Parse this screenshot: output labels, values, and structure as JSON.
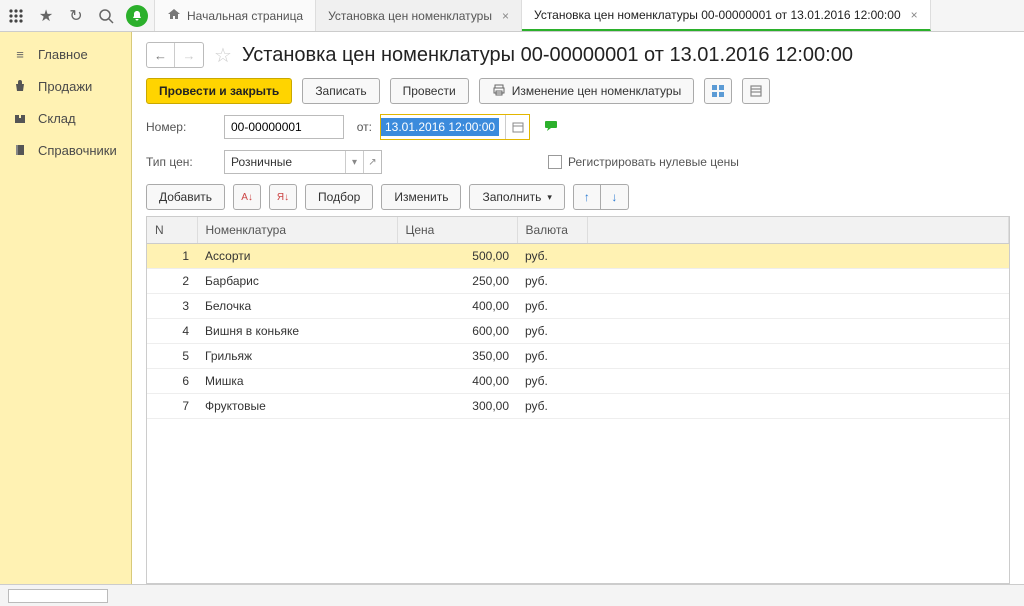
{
  "tabs": {
    "home": "Начальная страница",
    "t1": "Установка цен номенклатуры",
    "t2": "Установка цен номенклатуры 00-00000001 от 13.01.2016 12:00:00"
  },
  "sidebar": [
    {
      "label": "Главное",
      "name": "sidebar-main"
    },
    {
      "label": "Продажи",
      "name": "sidebar-sales"
    },
    {
      "label": "Склад",
      "name": "sidebar-warehouse"
    },
    {
      "label": "Справочники",
      "name": "sidebar-catalogs"
    }
  ],
  "title": "Установка цен номенклатуры 00-00000001 от 13.01.2016 12:00:00",
  "cmd": {
    "post_close": "Провести и закрыть",
    "write": "Записать",
    "post": "Провести",
    "price_change": "Изменение цен номенклатуры"
  },
  "fields": {
    "number_label": "Номер:",
    "number_value": "00-00000001",
    "date_label": "от:",
    "date_value": "13.01.2016 12:00:00",
    "type_label": "Тип цен:",
    "type_value": "Розничные",
    "reg_zero": "Регистрировать нулевые цены"
  },
  "tbl_tools": {
    "add": "Добавить",
    "pick": "Подбор",
    "change": "Изменить",
    "fill": "Заполнить"
  },
  "columns": {
    "n": "N",
    "nom": "Номенклатура",
    "price": "Цена",
    "cur": "Валюта"
  },
  "rows": [
    {
      "n": "1",
      "nom": "Ассорти",
      "price": "500,00",
      "cur": "руб."
    },
    {
      "n": "2",
      "nom": "Барбарис",
      "price": "250,00",
      "cur": "руб."
    },
    {
      "n": "3",
      "nom": "Белочка",
      "price": "400,00",
      "cur": "руб."
    },
    {
      "n": "4",
      "nom": "Вишня в коньяке",
      "price": "600,00",
      "cur": "руб."
    },
    {
      "n": "5",
      "nom": "Грильяж",
      "price": "350,00",
      "cur": "руб."
    },
    {
      "n": "6",
      "nom": "Мишка",
      "price": "400,00",
      "cur": "руб."
    },
    {
      "n": "7",
      "nom": "Фруктовые",
      "price": "300,00",
      "cur": "руб."
    }
  ]
}
